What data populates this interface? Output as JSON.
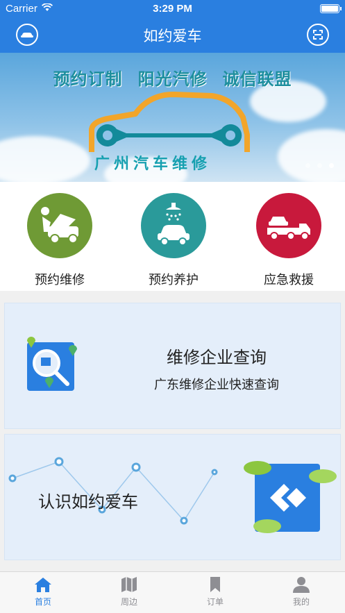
{
  "status_bar": {
    "carrier": "Carrier",
    "time": "3:29 PM"
  },
  "nav": {
    "title": "如约爱车",
    "left_icon": "car-icon",
    "right_icon": "scan-icon"
  },
  "banner": {
    "slogans": [
      "预约订制",
      "阳光汽修",
      "诚信联盟"
    ],
    "city_text": "广州汽车维修",
    "page_count": 3,
    "active_page": 3
  },
  "services": [
    {
      "label": "预约维修",
      "icon": "car-repair-icon",
      "color": "#6f9a35"
    },
    {
      "label": "预约养护",
      "icon": "car-wash-icon",
      "color": "#2a9a9a"
    },
    {
      "label": "应急救援",
      "icon": "tow-truck-icon",
      "color": "#c8193c"
    }
  ],
  "query_card": {
    "title": "维修企业查询",
    "subtitle": "广东维修企业快速查询",
    "icon": "search-map-icon"
  },
  "know_card": {
    "title": "认识如约爱车",
    "icon": "app-logo-icon"
  },
  "tabs": [
    {
      "label": "首页",
      "icon": "home-icon",
      "active": true
    },
    {
      "label": "周边",
      "icon": "map-icon",
      "active": false
    },
    {
      "label": "订单",
      "icon": "bookmark-icon",
      "active": false
    },
    {
      "label": "我的",
      "icon": "user-icon",
      "active": false
    }
  ],
  "colors": {
    "primary": "#2a7fe0",
    "card_bg": "#e4eefa"
  }
}
